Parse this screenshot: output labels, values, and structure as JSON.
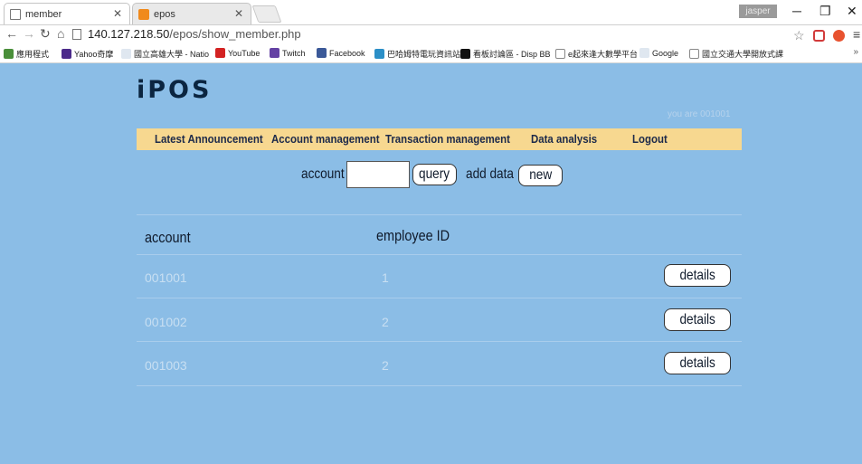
{
  "browser": {
    "tabs": [
      {
        "title": "member",
        "active": true
      },
      {
        "title": "epos",
        "active": false
      }
    ],
    "user": "jasper",
    "url_host": "140.127.218.50",
    "url_path": "/epos/show_member.php",
    "bookmarks": [
      "應用程式",
      "Yahoo奇摩",
      "國立高雄大學 - Natio",
      "YouTube",
      "Twitch",
      "Facebook",
      "巴哈姆特電玩資訊站",
      "看板討論區 - Disp BB",
      "e起來逢大數學平台",
      "Google",
      "國立交通大學開放式課"
    ]
  },
  "app": {
    "logo": "iPOS",
    "user_line": "you are 001001",
    "nav": [
      "Latest Announcement",
      "Account management",
      "Transaction management",
      "Data analysis",
      "Logout"
    ],
    "search": {
      "account_label": "account :",
      "account_value": "",
      "query_label": "query",
      "add_data_label": "add data",
      "new_label": "new"
    },
    "table": {
      "headers": [
        "account",
        "employee ID"
      ],
      "rows": [
        {
          "account": "001001",
          "employee_id": "1",
          "action": "details"
        },
        {
          "account": "001002",
          "employee_id": "2",
          "action": "details"
        },
        {
          "account": "001003",
          "employee_id": "2",
          "action": "details"
        }
      ]
    }
  }
}
